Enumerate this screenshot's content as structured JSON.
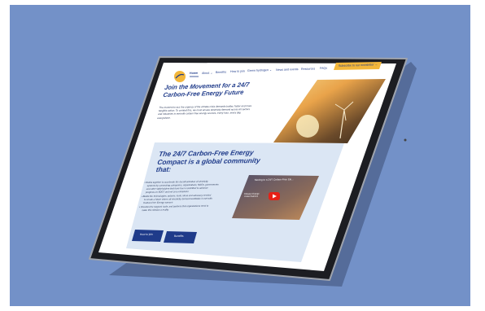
{
  "nav": {
    "items": [
      "Home",
      "About",
      "Benefits",
      "How to join",
      "Green hydrogen",
      "News and events",
      "Resources",
      "FAQs"
    ],
    "subscribe_label": "Subscribe to our newsletter",
    "subscribe_arrow": "→"
  },
  "hero": {
    "title_line1": "Join the Movement for a 24/7",
    "title_line2": "Carbon-Free Energy Future",
    "body_line1": "The moment to act, the urgency of the climate crisis demands bolder, faster and more",
    "body_line2": "tangible action. To combat this, we must ensure electricity demand across all sectors",
    "body_line3": "and industries is met with carbon-free energy sources, every hour, every day,",
    "body_line4": "everywhere."
  },
  "compact": {
    "title_line1": "The 24/7 Carbon-Free Energy",
    "title_line2": "Compact is a global community",
    "title_line3": "that:",
    "bullet1_line1": "Works together to accelerate the decarbonization of electricity",
    "bullet1_line2": "systems by connecting companies, organizations, NGOs, governments",
    "bullet1_line3": "and other stakeholders that have been committed to advance",
    "bullet1_line4": "progress on SDG7 and net zero emissions",
    "bullet2_line1": "Builds the technologies, policies, tools, ideas and advocacy needed",
    "bullet2_line2": "to create a future where all electricity demand worldwide is met with",
    "bullet2_line3": "Carbon-Free Energy sources",
    "bullet3_line1": "Provides the support, tools, and partners that organizations need to",
    "bullet3_line2": "make this mission a reality",
    "btn_join": "How to join",
    "btn_benefits": "Benefits"
  },
  "video": {
    "title": "Moving to a 24/7 Carbon-Free Ele...",
    "caption_line1": "Climate Change",
    "caption_line2": "United Nations"
  },
  "colors": {
    "background": "#7391c8",
    "brand_blue": "#1f3b8a",
    "accent_yellow": "#f3b73b",
    "panel": "#dbe6f4"
  }
}
